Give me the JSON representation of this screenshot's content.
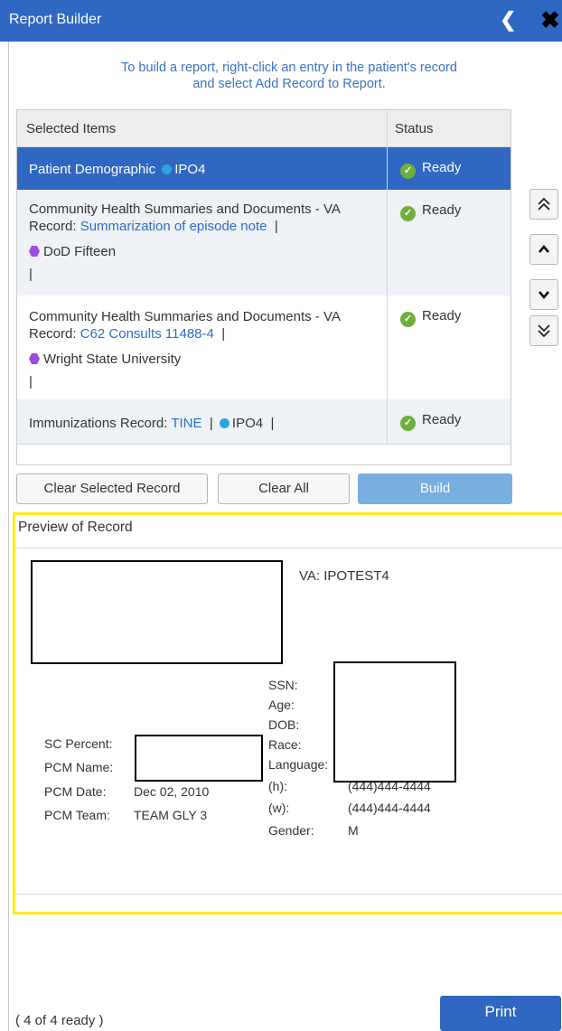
{
  "window": {
    "title": "Report Builder"
  },
  "instructions": {
    "line1": "To build a report, right-click an entry in the patient's record",
    "line2": "and select Add Record to Report."
  },
  "table": {
    "headers": {
      "items": "Selected Items",
      "status": "Status"
    },
    "rows": [
      {
        "label": "Patient Demographic",
        "site": "IPO4",
        "status": "Ready"
      },
      {
        "label": "Community Health Summaries and Documents - VA",
        "record_prefix": "Record:",
        "record_link": "Summarization of episode note",
        "sep": "|",
        "facility": "DoD Fifteen",
        "trail": "|",
        "status": "Ready"
      },
      {
        "label": "Community Health Summaries and Documents - VA",
        "record_prefix": "Record:",
        "record_link": "C62 Consults 11488-4",
        "sep": "|",
        "facility": "Wright State University",
        "trail": "|",
        "status": "Ready"
      },
      {
        "label": "Immunizations Record:",
        "record_link": "TINE",
        "sep": "|",
        "site": "IPO4",
        "sep2": "|",
        "status": "Ready"
      }
    ]
  },
  "buttons": {
    "clear_selected": "Clear Selected Record",
    "clear_all": "Clear All",
    "build": "Build",
    "print": "Print"
  },
  "preview": {
    "title": "Preview of Record",
    "va_id": "VA: IPOTEST4",
    "left_fields": {
      "sc_percent": "SC Percent:",
      "pcm_name": "PCM Name:",
      "pcm_date_label": "PCM Date:",
      "pcm_date_value": "Dec 02, 2010",
      "pcm_team_label": "PCM Team:",
      "pcm_team_value": "TEAM GLY 3"
    },
    "right_fields": {
      "ssn": "SSN:",
      "age": "Age:",
      "dob": "DOB:",
      "race": "Race:",
      "language": "Language:",
      "home_label": "(h):",
      "home_value": "(444)444-4444",
      "work_label": "(w):",
      "work_value": "(444)444-4444",
      "gender_label": "Gender:",
      "gender_value": "M"
    }
  },
  "footer": {
    "ready_count": "( 4 of 4 ready )"
  },
  "icons": {
    "back": "chevron-left-icon",
    "close": "close-icon",
    "move_top": "double-chevron-up-icon",
    "move_up": "chevron-up-icon",
    "move_down": "chevron-down-icon",
    "move_bottom": "double-chevron-down-icon",
    "ready": "check-circle-icon",
    "site_dot": "blue-dot-icon",
    "facility_hex": "purple-hexagon-icon"
  },
  "colors": {
    "header_blue": "#2f67c2",
    "link_blue": "#2f6ec6",
    "ready_green": "#6fae3e",
    "preview_border": "#ffea1c",
    "build_disabled": "#79aee0"
  }
}
